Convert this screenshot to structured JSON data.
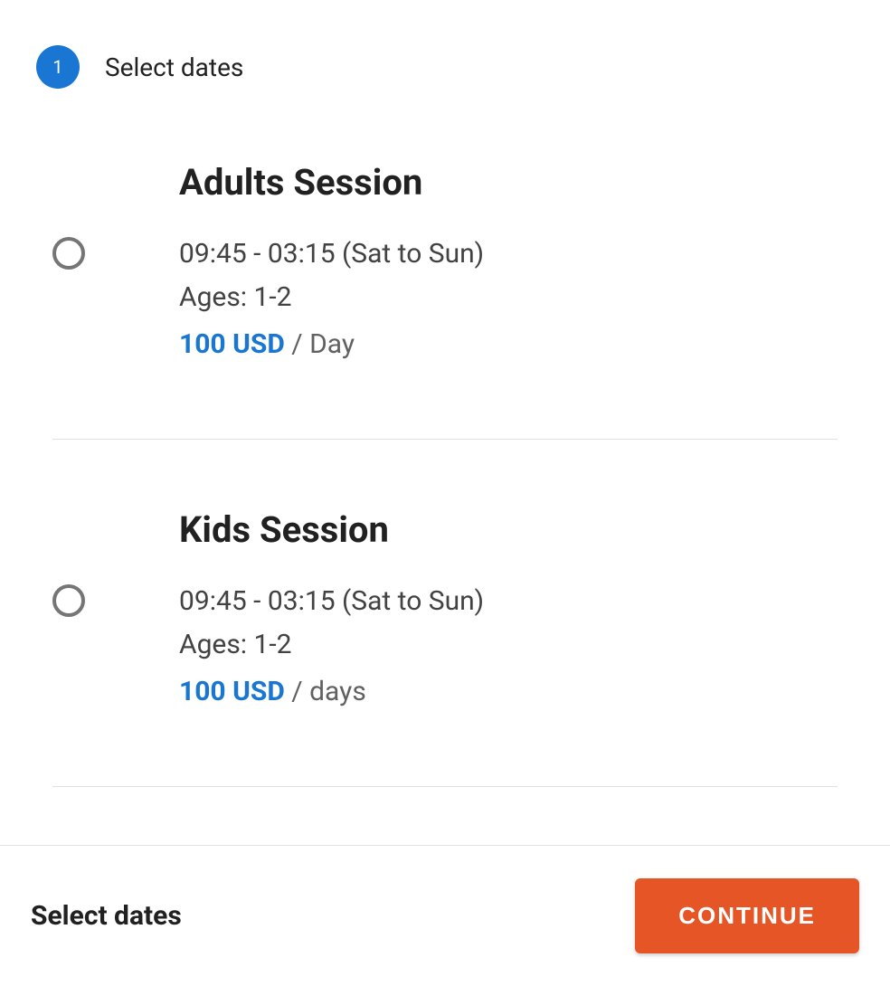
{
  "step": {
    "number": "1",
    "title": "Select dates"
  },
  "sessions": [
    {
      "title": "Adults Session",
      "time": "09:45 - 03:15 (Sat to Sun)",
      "ages": "Ages: 1-2",
      "price": "100 USD",
      "unit": " / Day"
    },
    {
      "title": "Kids Session",
      "time": "09:45 - 03:15 (Sat to Sun)",
      "ages": "Ages: 1-2",
      "price": "100 USD",
      "unit": " / days"
    }
  ],
  "bottomBar": {
    "label": "Select dates",
    "button": "CONTINUE"
  }
}
